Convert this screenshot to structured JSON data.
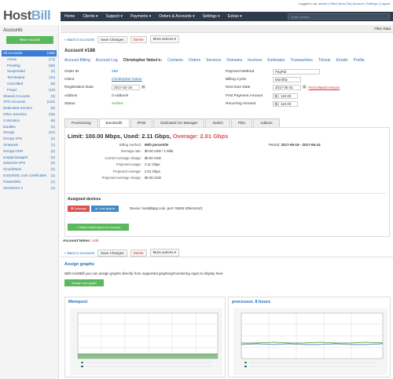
{
  "header": {
    "logo_main": "Host",
    "logo_accent": "Bill",
    "logged_in_prefix": "Logged in as:",
    "user": "admin",
    "links": [
      "Client Area",
      "My Account",
      "Settings",
      "Logout"
    ]
  },
  "nav": {
    "items": [
      "Home",
      "Clients ▾",
      "Support ▾",
      "Payments ▾",
      "Orders & Accounts ▾",
      "Settings ▾",
      "Extras ▾"
    ],
    "search_placeholder": "Smart search"
  },
  "sidebar": {
    "title": "Accounts",
    "new_button": "New Account",
    "items": [
      {
        "label": "All Accounts",
        "count": "(189)",
        "sub": false,
        "active": true
      },
      {
        "label": "Active",
        "count": "(71)",
        "sub": true
      },
      {
        "label": "Pending",
        "count": "(68)",
        "sub": true
      },
      {
        "label": "Suspended",
        "count": "(4)",
        "sub": true
      },
      {
        "label": "Terminated",
        "count": "(11)",
        "sub": true
      },
      {
        "label": "Cancelled",
        "count": "(6)",
        "sub": true
      },
      {
        "label": "Fraud",
        "count": "(19)",
        "sub": true
      },
      {
        "label": "Shared Accounts",
        "count": "(3)",
        "sub": false
      },
      {
        "label": "VPS Accounts",
        "count": "(124)",
        "sub": false
      },
      {
        "label": "Dedicated Servers",
        "count": "(5)",
        "sub": false
      },
      {
        "label": "Other Services",
        "count": "(26)",
        "sub": false
      },
      {
        "label": "Colocation",
        "count": "(8)",
        "sub": false
      },
      {
        "label": "bundles",
        "count": "(1)",
        "sub": false
      },
      {
        "label": "OnApp",
        "count": "(21)",
        "sub": false
      },
      {
        "label": "OnApp VPS",
        "count": "(2)",
        "sub": false
      },
      {
        "label": "Vmware6",
        "count": "(1)",
        "sub": false
      },
      {
        "label": "OnApp CDN",
        "count": "(2)",
        "sub": false
      },
      {
        "label": "snappmanaged",
        "count": "(2)",
        "sub": false
      },
      {
        "label": "SolusVM VPS",
        "count": "(2)",
        "sub": false
      },
      {
        "label": "CloudStack",
        "count": "(1)",
        "sub": false
      },
      {
        "label": "GoGetSSL.com Certificates",
        "count": "(1)",
        "sub": false
      },
      {
        "label": "PowerDNS",
        "count": "(1)",
        "sub": false
      },
      {
        "label": "XenServer 2",
        "count": "(1)",
        "sub": false
      }
    ]
  },
  "toolbar": {
    "back": "« Back to accounts",
    "save": "Save Changes",
    "delete": "Delete",
    "more": "More actions ▾",
    "filter": "Filter Data"
  },
  "account": {
    "title": "Account #188",
    "tabs": [
      "Account Billing",
      "Account Log",
      "Christopher Nolun's:",
      "Contacts",
      "Orders",
      "Services",
      "Domains",
      "Invoices",
      "Estimates",
      "Transactions",
      "Tickets",
      "Emails",
      "Profile"
    ],
    "left_fields": [
      {
        "label": "Order ID",
        "value": "255"
      },
      {
        "label": "Client",
        "value": "Christopher Nolun"
      },
      {
        "label": "Registration Date",
        "value": "2017-02-16"
      },
      {
        "label": "Addons",
        "value": "0 Addon/s"
      },
      {
        "label": "Status",
        "value": "Active"
      }
    ],
    "right_fields": [
      {
        "label": "Payment Method",
        "value": "PayPal"
      },
      {
        "label": "Billing Cycle",
        "value": "Monthly"
      },
      {
        "label": "Next Due Date",
        "value": "2017-05-31"
      },
      {
        "label": "First Payment Amount",
        "value": "110.00"
      },
      {
        "label": "Recurring Amount",
        "value": "110.00"
      }
    ],
    "related_invoices": "Find related invoices",
    "currency": "$"
  },
  "subtabs": [
    "Provisioning",
    "Bandwidth",
    "IPAM",
    "Dedicated Srv Manager",
    "Switch",
    "PDU",
    "Addons"
  ],
  "bandwidth": {
    "limit": "Limit: 100.00 Mbps, Used: 2.11 Gbps,",
    "overage": "Overage: 2.01 Gbps",
    "period_label": "Period:",
    "period": "2017-05-19 - 2017-05-24",
    "stats": [
      {
        "label": "Billing method:",
        "value": "95th percentile"
      },
      {
        "label": "Overage rate:",
        "value": "$0.00 USD / 1 Mbit"
      },
      {
        "label": "Current overage charge:",
        "value": "$0.00 USD"
      },
      {
        "label": "Projected usage:",
        "value": "2.11 Gbps"
      },
      {
        "label": "Projected overage:",
        "value": "2.01 Gbps"
      },
      {
        "label": "Projected overage charge:",
        "value": "$0.00 USD"
      }
    ],
    "assigned_title": "Assigned devices",
    "unassign": "✖ Unassign",
    "load_graphs": "▲ Load graphs",
    "device": "Device: hostbillapp.com, port: #6834 Ethernet1/1",
    "select_btn": "+ Select switch/ports to connect"
  },
  "notes": {
    "label": "Account Notes:",
    "add": "Add"
  },
  "graphs": {
    "title": "Assign graphs",
    "desc": "With HostBill you can assign graphs directly from supported graphing/monitoring Apps to display here",
    "new_button": "Assign new graph",
    "mempool": {
      "title": "Mempool"
    },
    "processor": {
      "title": "processor, 8 hours"
    }
  },
  "colors": {
    "nav": "#2f3b4a",
    "link": "#2a6ebb",
    "green": "#5cb85c",
    "red": "#d9534f",
    "blue": "#428bca"
  }
}
